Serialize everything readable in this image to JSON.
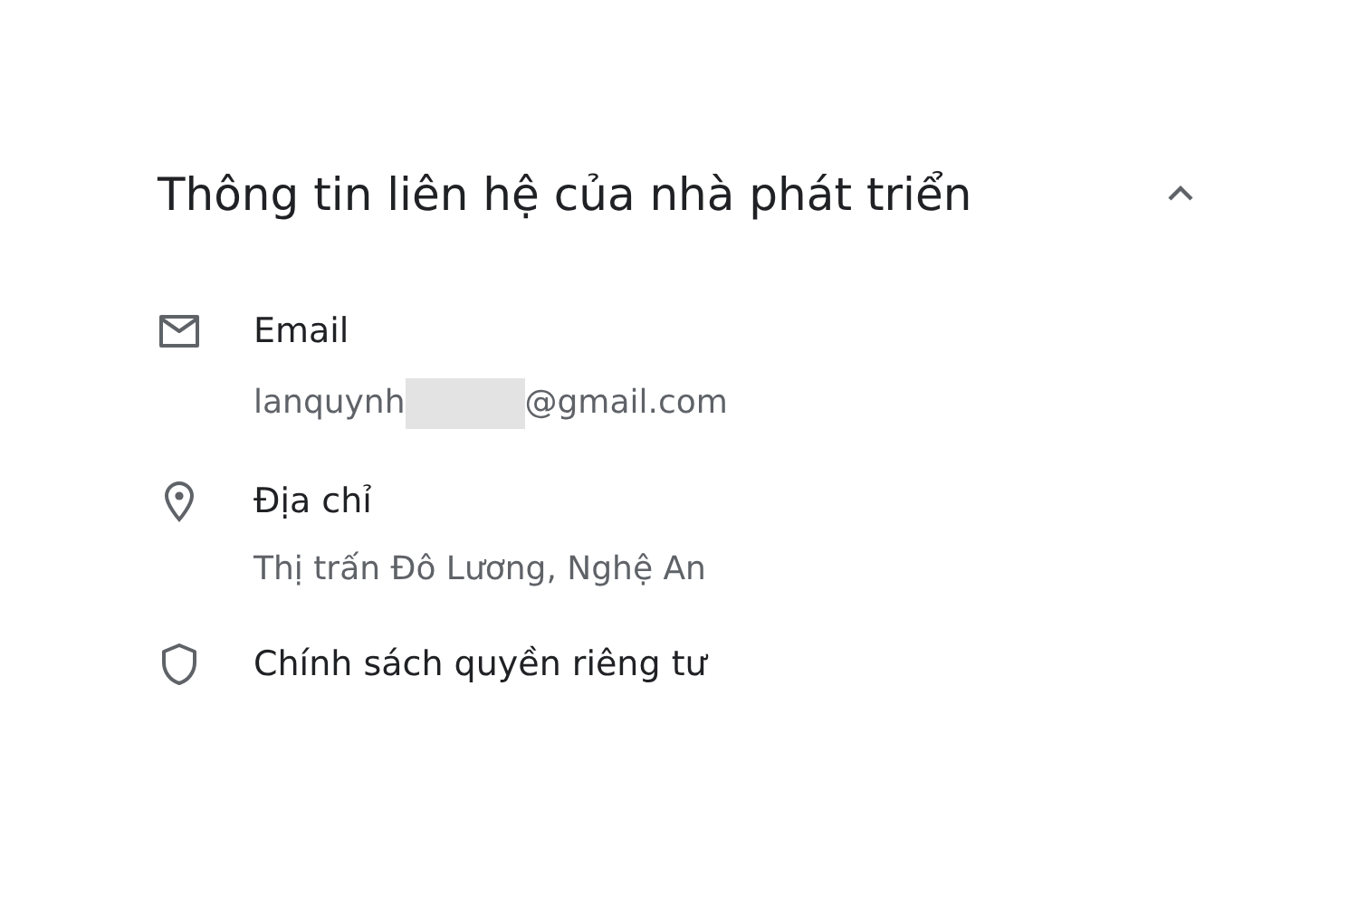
{
  "section": {
    "title": "Thông tin liên hệ của nhà phát triển",
    "expanded": true
  },
  "items": [
    {
      "kind": "email",
      "label": "Email",
      "value_parts": [
        "lanquynh",
        "@gmail.com"
      ]
    },
    {
      "kind": "address",
      "label": "Địa chỉ",
      "value_parts": [
        "Thị trấn Đô Lương, Nghệ An"
      ]
    },
    {
      "kind": "privacy",
      "label": "Chính sách quyền riêng tư"
    }
  ]
}
